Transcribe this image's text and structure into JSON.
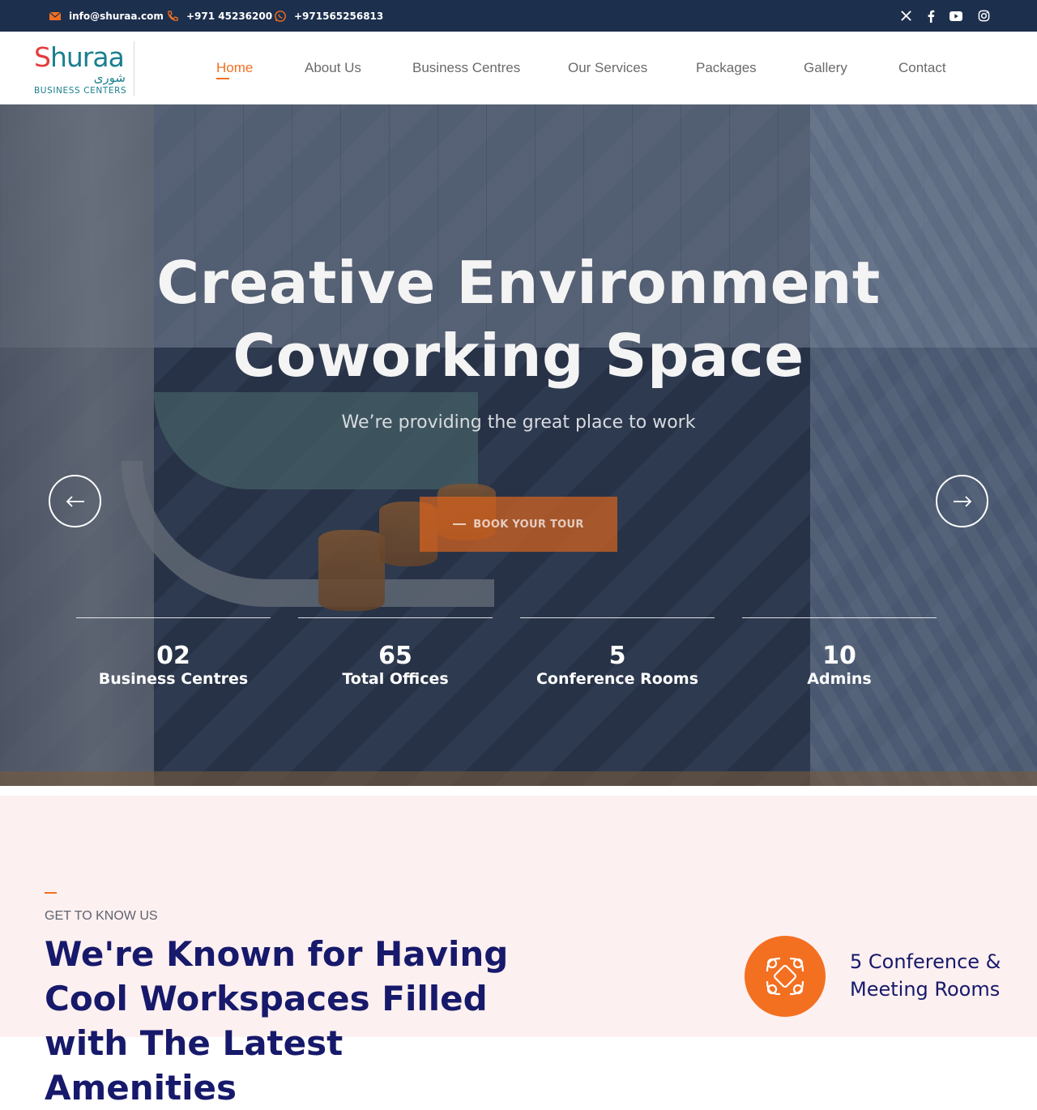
{
  "topbar": {
    "email": "info@shuraa.com",
    "phone": "+971 45236200",
    "whatsapp": "+971565256813",
    "social": [
      "x-icon",
      "facebook-icon",
      "youtube-icon",
      "instagram-icon"
    ]
  },
  "brand": {
    "name_s": "S",
    "name_rest": "huraa",
    "arabic": "شورى",
    "subtitle": "BUSINESS CENTERS"
  },
  "nav": {
    "items": [
      "Home",
      "About Us",
      "Business Centres",
      "Our Services",
      "Packages",
      "Gallery",
      "Contact"
    ],
    "active": "Home"
  },
  "hero": {
    "title_line1": "Creative Environment",
    "title_line2": "Coworking Space",
    "subtitle": "We’re providing the great place to work",
    "cta": "BOOK YOUR TOUR",
    "stats": [
      {
        "value": "02",
        "label": "Business Centres"
      },
      {
        "value": "65",
        "label": "Total Offices"
      },
      {
        "value": "5",
        "label": "Conference Rooms"
      },
      {
        "value": "10",
        "label": "Admins"
      }
    ]
  },
  "about": {
    "eyebrow": "GET TO KNOW US",
    "heading": "We're Known for Having Cool Workspaces Filled with The Latest Amenities",
    "feature": "5 Conference & Meeting Rooms"
  },
  "colors": {
    "accent": "#f37021",
    "navy": "#17196b",
    "topbar": "#1c2f4d",
    "about_bg": "#fdf0f0"
  }
}
